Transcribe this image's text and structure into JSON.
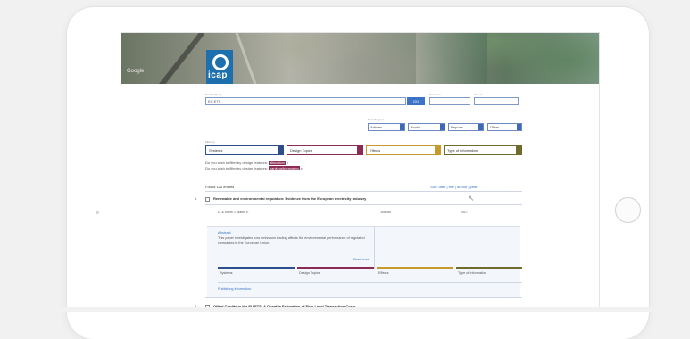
{
  "banner": {
    "map_label": "Google",
    "logo_text": "icap"
  },
  "search": {
    "label": "Search Query",
    "value": "EU ETS",
    "go_label": "GO",
    "year_from_label": "Year from",
    "year_to_label": "Year to"
  },
  "type_filters": {
    "label": "Search Types",
    "items": [
      "Articles",
      "Books",
      "Reports",
      "Other"
    ]
  },
  "category_filters": {
    "label": "Filter by",
    "items": [
      {
        "label": "Systems",
        "color": "#2d4e8a"
      },
      {
        "label": "Design Topics",
        "color": "#8b2a53"
      },
      {
        "label": "Effects",
        "color": "#c59a2b"
      },
      {
        "label": "Type of information",
        "color": "#6f6a2e"
      }
    ]
  },
  "notes": {
    "line1_prefix": "Do you wish to filter by design features:",
    "line1_tag": "allocation",
    "line1_suffix": "x",
    "line2_prefix": "Do you wish to filter by design features:",
    "line2_tag": "banking/borrowing",
    "line2_suffix": "x"
  },
  "results": {
    "count_text": "Found 120 entries",
    "sort_text": "Sort: date | title | author | year",
    "items": [
      {
        "index": "1.",
        "title": "Renewable and environmental regulation: Evidence from the European electricity industry",
        "authors_label": "D. & Smith J, Martin E",
        "col_journal": "Journal",
        "col_year": "2017",
        "abstract_title": "Abstract",
        "abstract_text": "This paper investigates how emissions trading affects the environmental performance of regulated companies in the European Union.",
        "read_more": "Read more",
        "tags": [
          "Systems",
          "Design Topics",
          "Effects",
          "Type of information"
        ],
        "pub_info": "Publishing information"
      },
      {
        "index": "2.",
        "title": "Offset Credits in the EU ETS: A Quantile Estimation of Firm-Level Transaction Costs"
      }
    ]
  }
}
